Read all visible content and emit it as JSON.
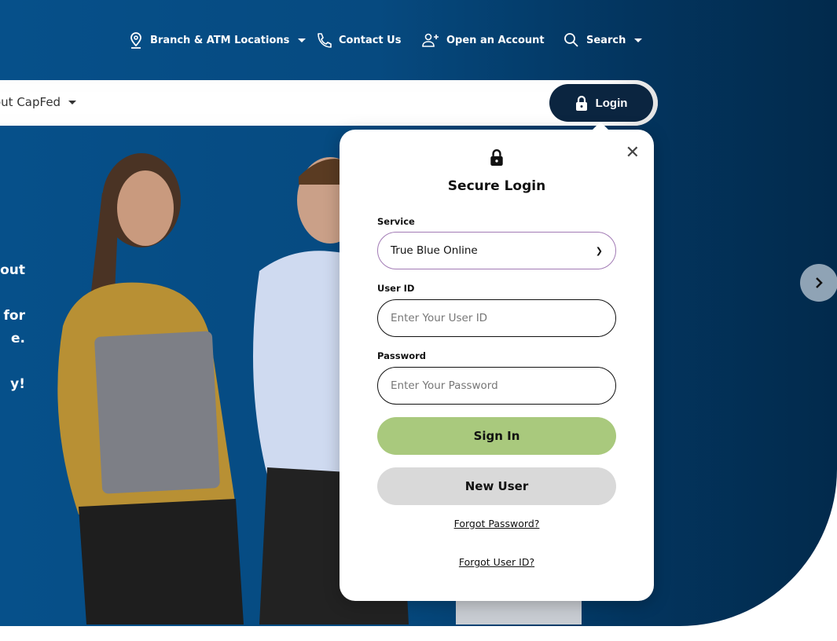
{
  "colors": {
    "navy": "#0b2540",
    "hero_blue": "#06508a",
    "sign_in": "#a9c97d",
    "new_user": "#d9d9d9",
    "select_border": "#a27bb5"
  },
  "topnav": [
    {
      "label": "Branch & ATM Locations",
      "icon": "map-pin-icon",
      "dropdown": true
    },
    {
      "label": "Contact Us",
      "icon": "phone-icon"
    },
    {
      "label": "Open an Account",
      "icon": "user-plus-icon"
    },
    {
      "label": "Search",
      "icon": "search-icon",
      "dropdown": true
    }
  ],
  "mainnav": {
    "about": "out CapFed",
    "login": "Login"
  },
  "hero": {
    "lines": [
      "out",
      "",
      "l for",
      "e.",
      "",
      "y!"
    ]
  },
  "login": {
    "title": "Secure Login",
    "service_label": "Service",
    "service_value": "True Blue Online",
    "userid_label": "User ID",
    "userid_placeholder": "Enter Your User ID",
    "password_label": "Password",
    "password_placeholder": "Enter Your Password",
    "sign_in": "Sign In",
    "new_user": "New User",
    "forgot_password": "Forgot Password?",
    "forgot_userid": "Forgot User ID?"
  }
}
